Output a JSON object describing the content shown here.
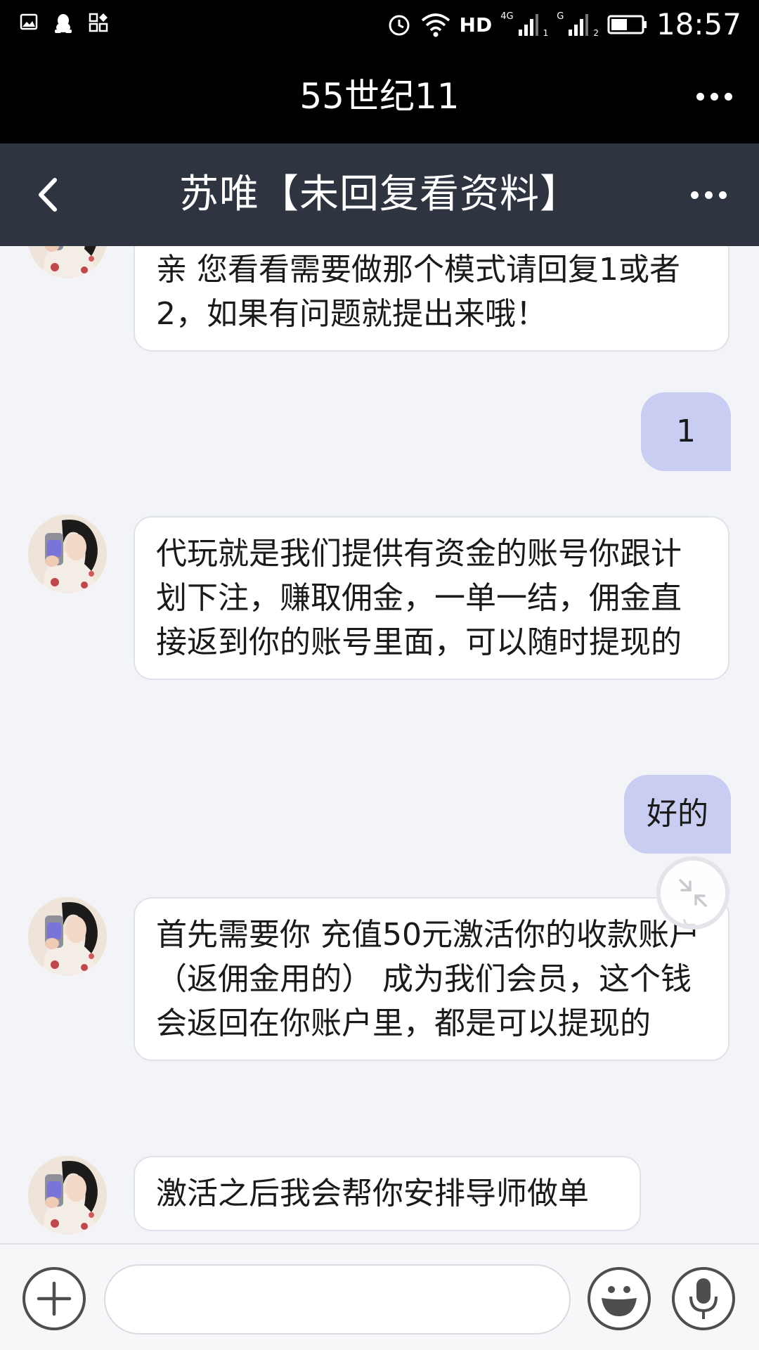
{
  "status_bar": {
    "time": "18:57",
    "hd": "HD",
    "net1": "4G",
    "sim1": "1",
    "net2": "G",
    "sim2": "2",
    "icons": [
      "image-icon",
      "qq-icon",
      "apps-icon",
      "alarm-icon",
      "wifi-icon",
      "signal-icon",
      "battery-icon"
    ]
  },
  "app_bar": {
    "title": "55世纪11"
  },
  "chat_header": {
    "title": "苏唯【未回复看资料】"
  },
  "messages": [
    {
      "from": "contact",
      "text": "亲 您看看需要做那个模式请回复1或者2，如果有问题就提出来哦！"
    },
    {
      "from": "me",
      "text": "1"
    },
    {
      "from": "contact",
      "text": "代玩就是我们提供有资金的账号你跟计划下注，赚取佣金，一单一结，佣金直接返到你的账号里面，可以随时提现的"
    },
    {
      "from": "me",
      "text": "好的"
    },
    {
      "from": "contact",
      "text": "首先需要你 充值50元激活你的收款账户（返佣金用的） 成为我们会员，这个钱会返回在你账户里，都是可以提现的"
    },
    {
      "from": "contact",
      "text": "激活之后我会帮你安排导师做单"
    }
  ],
  "input_bar": {
    "placeholder": "",
    "value": ""
  },
  "colors": {
    "header_bg": "#2f3441",
    "outgoing_bubble": "#c8cdf1",
    "incoming_bubble": "#ffffff",
    "chat_bg": "#f3f4f8"
  }
}
